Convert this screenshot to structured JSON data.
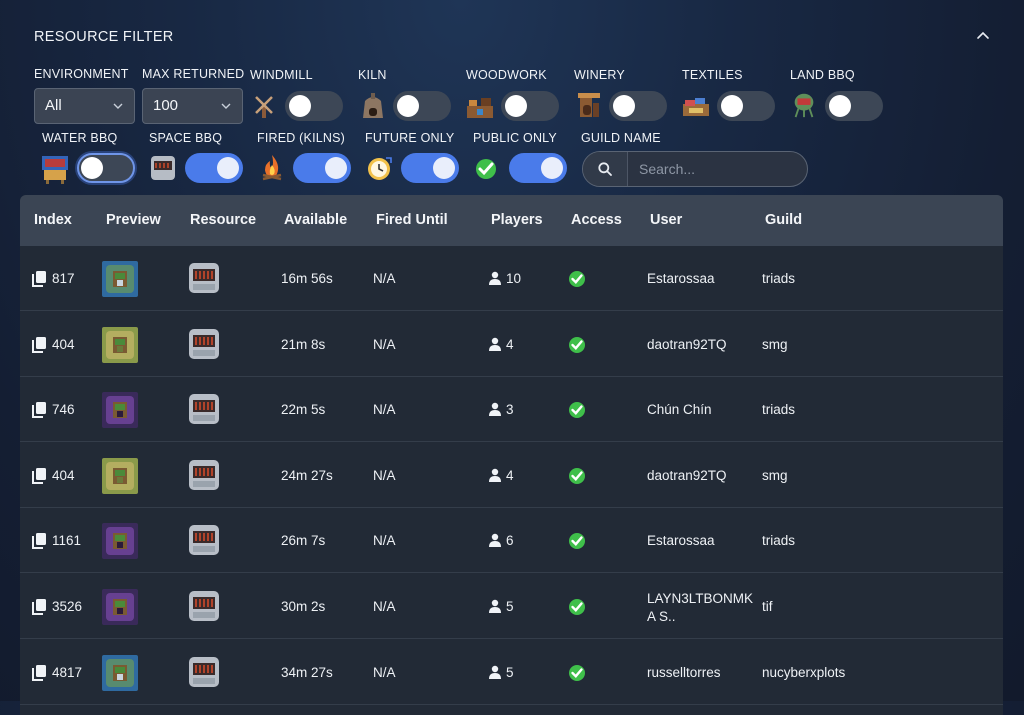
{
  "filter": {
    "title": "RESOURCE FILTER",
    "environment": {
      "label": "ENVIRONMENT",
      "value": "All"
    },
    "max_returned": {
      "label": "MAX RETURNED",
      "value": "100"
    },
    "toggles": [
      {
        "label": "WINDMILL",
        "icon": "windmill-icon",
        "on": false
      },
      {
        "label": "KILN",
        "icon": "kiln-icon",
        "on": false
      },
      {
        "label": "WOODWORK",
        "icon": "woodwork-icon",
        "on": false
      },
      {
        "label": "WINERY",
        "icon": "winery-icon",
        "on": false
      },
      {
        "label": "TEXTILES",
        "icon": "textiles-icon",
        "on": false
      },
      {
        "label": "LAND BBQ",
        "icon": "land-bbq-icon",
        "on": false
      },
      {
        "label": "WATER BBQ",
        "icon": "water-bbq-icon",
        "on": false
      },
      {
        "label": "SPACE BBQ",
        "icon": "space-bbq-icon",
        "on": true
      },
      {
        "label": "FIRED (KILNS)",
        "icon": "fire-icon",
        "on": true
      },
      {
        "label": "FUTURE ONLY",
        "icon": "clock-icon",
        "on": true
      },
      {
        "label": "PUBLIC ONLY",
        "icon": "checkmark-icon",
        "on": true
      }
    ],
    "guild_name": {
      "label": "GUILD NAME",
      "placeholder": "Search..."
    }
  },
  "table": {
    "headers": [
      "Index",
      "Preview",
      "Resource",
      "Available",
      "Fired Until",
      "Players",
      "Access",
      "User",
      "Guild"
    ],
    "rows": [
      {
        "index": "817",
        "preview": "water",
        "available": "16m 56s",
        "fired_until": "N/A",
        "players": "10",
        "user": "Estarossaa",
        "guild": "triads"
      },
      {
        "index": "404",
        "preview": "land",
        "available": "21m 8s",
        "fired_until": "N/A",
        "players": "4",
        "user": "daotran92TQ",
        "guild": "smg"
      },
      {
        "index": "746",
        "preview": "space",
        "available": "22m 5s",
        "fired_until": "N/A",
        "players": "3",
        "user": "Chún Chín",
        "guild": "triads"
      },
      {
        "index": "404",
        "preview": "land",
        "available": "24m 27s",
        "fired_until": "N/A",
        "players": "4",
        "user": "daotran92TQ",
        "guild": "smg"
      },
      {
        "index": "1161",
        "preview": "space",
        "available": "26m 7s",
        "fired_until": "N/A",
        "players": "6",
        "user": "Estarossaa",
        "guild": "triads"
      },
      {
        "index": "3526",
        "preview": "space",
        "available": "30m 2s",
        "fired_until": "N/A",
        "players": "5",
        "user": "LAYN3LTBONMK",
        "user_line2": "A S..",
        "guild": "tif"
      },
      {
        "index": "4817",
        "preview": "water",
        "available": "34m 27s",
        "fired_until": "N/A",
        "players": "5",
        "user": "russelltorres",
        "guild": "nucyberxplots"
      }
    ]
  },
  "colors": {
    "toggle_on": "#4a7bea",
    "toggle_off": "#3d4756",
    "check": "#3fbf4a",
    "header_bg": "#3b4554"
  }
}
